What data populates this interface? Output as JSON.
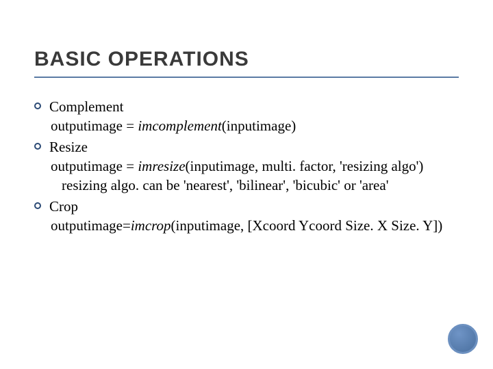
{
  "title": "BASIC OPERATIONS",
  "items": [
    {
      "head": "Complement",
      "sub": [
        {
          "pre": "outputimage = ",
          "fn": "imcomplement",
          "post": "(inputimage)"
        }
      ]
    },
    {
      "head": "Resize",
      "sub": [
        {
          "pre": "outputimage = ",
          "fn": "imresize",
          "post": "(inputimage, multi. factor, 'resizing algo')"
        }
      ],
      "sub2": [
        "resizing algo. can be 'nearest', 'bilinear', 'bicubic' or 'area'"
      ]
    },
    {
      "head": "Crop",
      "sub": [
        {
          "pre": "outputimage=",
          "fn": "imcrop",
          "post": "(inputimage, [Xcoord Ycoord Size. X Size. Y])"
        }
      ]
    }
  ]
}
